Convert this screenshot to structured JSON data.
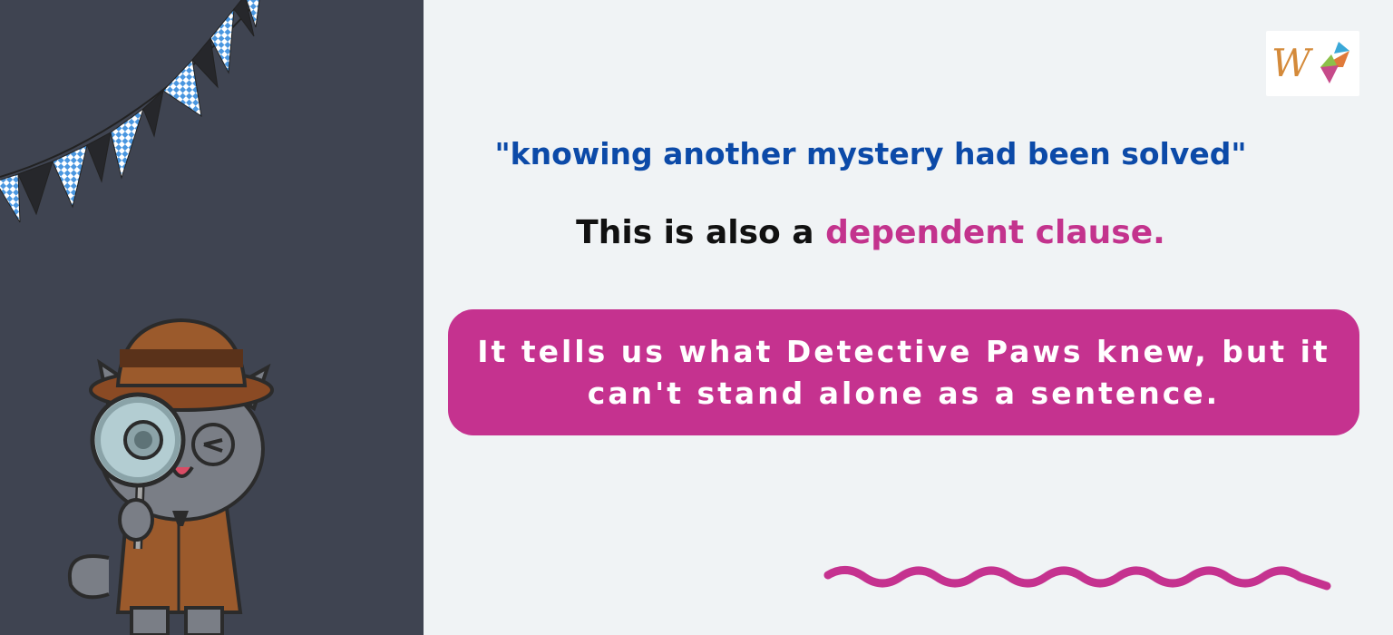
{
  "quote": "\"knowing another mystery had been solved\"",
  "clause": {
    "prefix": "This is also a ",
    "highlight": "dependent clause."
  },
  "callout": "It tells us what Detective Paws knew, but it can't stand alone as a sentence.",
  "colors": {
    "left_panel": "#3f4451",
    "background": "#f0f3f5",
    "quote": "#0c4aa8",
    "highlight": "#c3338d",
    "callout": "#c5328f"
  },
  "icons": [
    "bunting-flags",
    "detective-cat-illustration",
    "brand-logo",
    "squiggle-wave"
  ]
}
